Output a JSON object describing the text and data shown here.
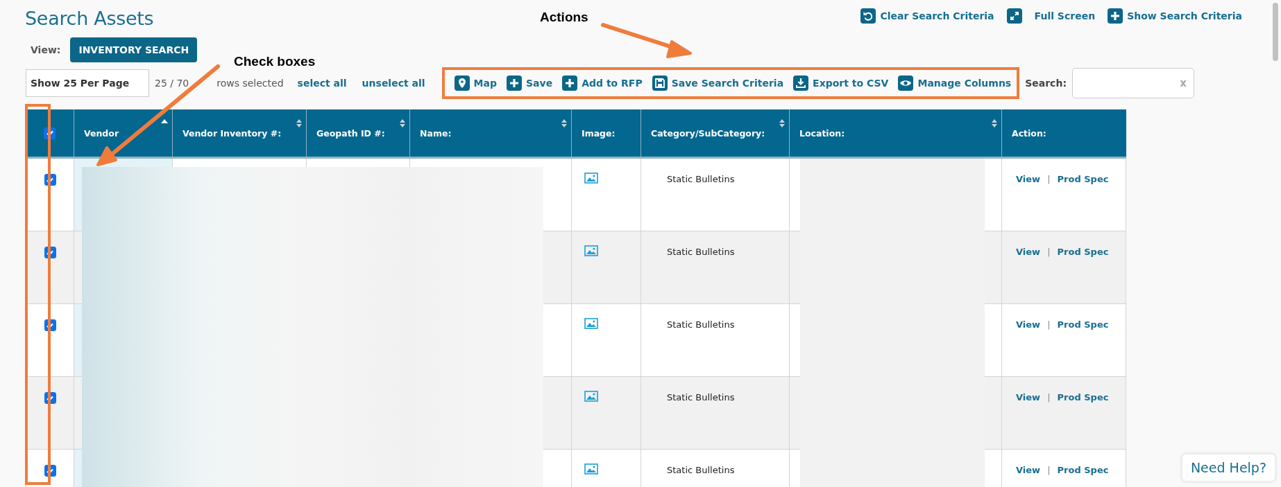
{
  "page": {
    "title": "Search Assets"
  },
  "top_links": [
    {
      "label": "Clear Search Criteria"
    },
    {
      "label": "Full Screen"
    },
    {
      "label": "Show Search Criteria"
    }
  ],
  "view": {
    "label": "View:",
    "button": "INVENTORY SEARCH"
  },
  "page_size": {
    "value": "Show 25 Per Page"
  },
  "selection": {
    "count": "25 / 70",
    "suffix": "rows selected",
    "select_all": "select all",
    "unselect_all": "unselect all"
  },
  "actions": [
    {
      "label": "Map"
    },
    {
      "label": "Save"
    },
    {
      "label": "Add to RFP"
    },
    {
      "label": "Save Search Criteria"
    },
    {
      "label": "Export to CSV"
    },
    {
      "label": "Manage Columns"
    }
  ],
  "search": {
    "label": "Search:",
    "clear": "x"
  },
  "table": {
    "select_all_checked": true,
    "columns": [
      {
        "label": "Vendor"
      },
      {
        "label": "Vendor Inventory #:"
      },
      {
        "label": "Geopath ID #:"
      },
      {
        "label": "Name:"
      },
      {
        "label": "Image:"
      },
      {
        "label": "Category/SubCategory:"
      },
      {
        "label": "Location:"
      },
      {
        "label": "Action:"
      }
    ],
    "rows": [
      {
        "checked": true,
        "category": "Static Bulletins",
        "view": "View",
        "separator": "|",
        "prod_spec": "Prod Spec"
      },
      {
        "checked": true,
        "category": "Static Bulletins",
        "view": "View",
        "separator": "|",
        "prod_spec": "Prod Spec"
      },
      {
        "checked": true,
        "category": "Static Bulletins",
        "view": "View",
        "separator": "|",
        "prod_spec": "Prod Spec"
      },
      {
        "checked": true,
        "category": "Static Bulletins",
        "view": "View",
        "separator": "|",
        "prod_spec": "Prod Spec"
      },
      {
        "checked": true,
        "category": "Static Bulletins",
        "view": "View",
        "separator": "|",
        "prod_spec": "Prod Spec"
      }
    ]
  },
  "annotations": [
    {
      "kind": "actions",
      "text": "Actions"
    },
    {
      "kind": "checkboxes",
      "text": "Check boxes"
    }
  ],
  "help": {
    "label": "Need Help?"
  }
}
